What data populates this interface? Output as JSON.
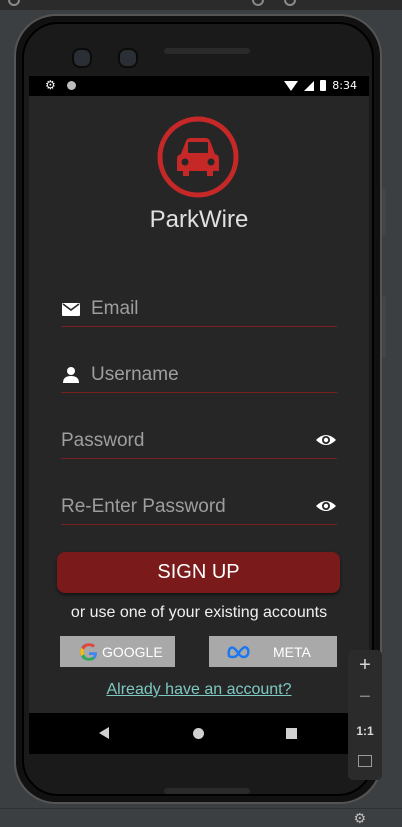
{
  "status_bar": {
    "time": "8:34"
  },
  "app": {
    "title": "ParkWire"
  },
  "form": {
    "email_placeholder": "Email",
    "username_placeholder": "Username",
    "password_placeholder": "Password",
    "reenter_password_placeholder": "Re-Enter Password"
  },
  "actions": {
    "signup_label": "SIGN UP",
    "or_text": "or use one of your existing accounts",
    "google_label": "GOOGLE",
    "meta_label": "META",
    "login_link": "Already have an account?"
  },
  "emulator_controls": {
    "zoom_in": "+",
    "zoom_out": "−",
    "actual_size": "1:1"
  },
  "icons": {
    "logo": "car-icon",
    "email": "mail-icon",
    "username": "person-icon",
    "password_toggle": "eye-icon",
    "google": "google-icon",
    "meta": "meta-icon"
  },
  "colors": {
    "accent": "#c62828",
    "button": "#7a1a1a",
    "background": "#262626",
    "link": "#7ec8c2",
    "social_button": "#a9a9a9"
  }
}
